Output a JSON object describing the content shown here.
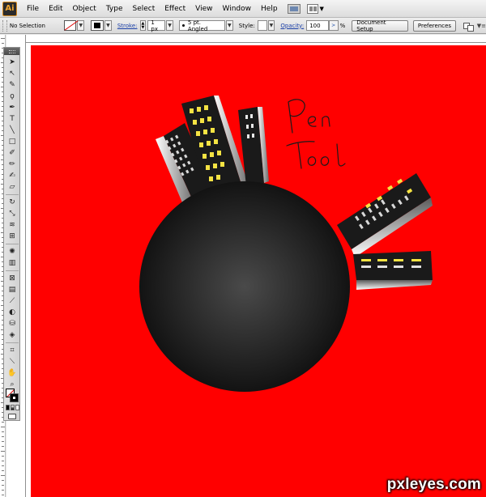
{
  "menubar": {
    "app_logo": "Ai",
    "items": [
      "File",
      "Edit",
      "Object",
      "Type",
      "Select",
      "Effect",
      "View",
      "Window",
      "Help"
    ]
  },
  "controlbar": {
    "selection_label": "No Selection",
    "stroke_label": "Stroke:",
    "stroke_weight": "1 px",
    "brush_label": "5 pt. Angled",
    "style_label": "Style:",
    "opacity_label": "Opacity:",
    "opacity_value": "100",
    "opacity_unit": "%",
    "document_setup": "Document Setup",
    "preferences": "Preferences"
  },
  "canvas": {
    "background_color": "#ff0000",
    "handwritten_text": [
      "Pen",
      "Tool"
    ],
    "planet_colors": {
      "center": "#4a4a4a",
      "edge": "#0d0d0d"
    },
    "window_color": "#f5e343"
  },
  "watermark": "pxleyes.com"
}
